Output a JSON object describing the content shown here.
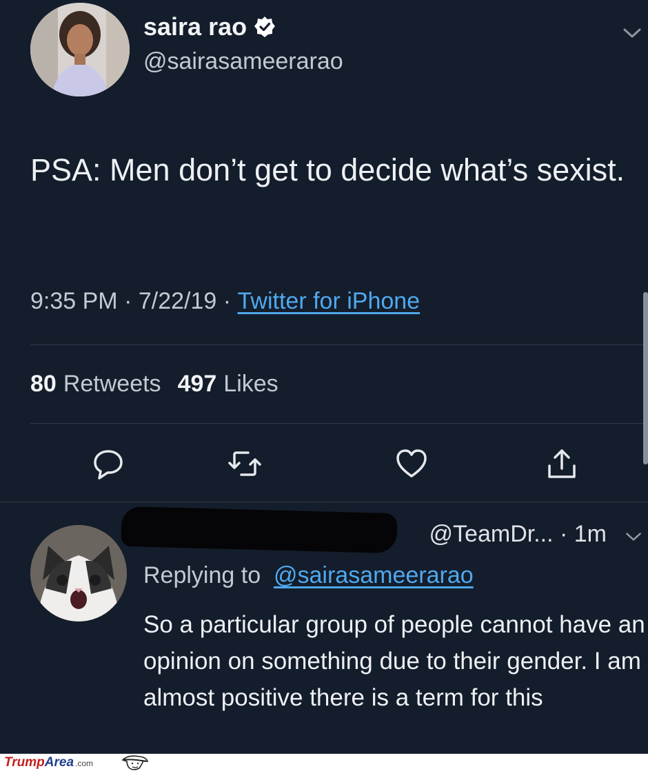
{
  "tweet": {
    "author_name": "saira rao",
    "author_handle": "@sairasameerarao",
    "verified_icon": "verified-badge-icon",
    "text": "PSA: Men don’t get to decide what’s sexist.",
    "time": "9:35 PM",
    "date": "7/22/19",
    "sep1": " · ",
    "sep2": " · ",
    "source": "Twitter for iPhone",
    "retweets_count": "80",
    "retweets_label": "Retweets",
    "likes_count": "497",
    "likes_label": "Likes",
    "actions": [
      "reply-icon",
      "retweet-icon",
      "like-icon",
      "share-icon"
    ]
  },
  "reply": {
    "handle": "@TeamDr...",
    "time": "· 1m",
    "replying_prefix": "Replying to ",
    "replying_to": "@sairasameerarao",
    "text": "So a particular group of people cannot have an opinion on something due to their gender. I am almost positive there is a term for this"
  },
  "watermark": {
    "part1": "Trump",
    "part2": "Area",
    "part3": ".com"
  },
  "colors": {
    "background": "#141d2b",
    "link": "#4fa9ef",
    "text_primary": "#eef1f4",
    "text_secondary": "#c3cad3"
  }
}
